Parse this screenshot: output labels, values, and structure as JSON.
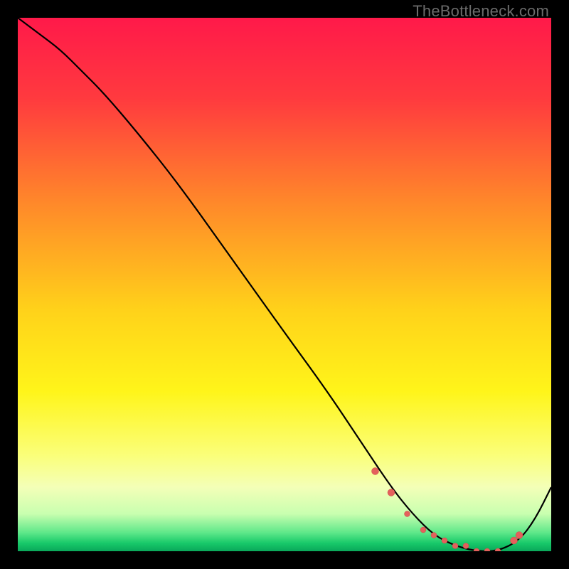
{
  "watermark": "TheBottleneck.com",
  "colors": {
    "bg": "#000000",
    "curve": "#000000",
    "marker_fill": "#e4605c",
    "marker_stroke": "#c94f4b"
  },
  "chart_data": {
    "type": "line",
    "title": "",
    "xlabel": "",
    "ylabel": "",
    "xlim": [
      0,
      100
    ],
    "ylim": [
      0,
      100
    ],
    "gradient_stops": [
      {
        "offset": 0.0,
        "color": "#ff1a4a"
      },
      {
        "offset": 0.15,
        "color": "#ff3a3f"
      },
      {
        "offset": 0.35,
        "color": "#ff8a2a"
      },
      {
        "offset": 0.55,
        "color": "#ffd31a"
      },
      {
        "offset": 0.7,
        "color": "#fff51a"
      },
      {
        "offset": 0.82,
        "color": "#fbff7a"
      },
      {
        "offset": 0.88,
        "color": "#f4ffb8"
      },
      {
        "offset": 0.93,
        "color": "#c9ffb0"
      },
      {
        "offset": 0.965,
        "color": "#5fe88a"
      },
      {
        "offset": 0.985,
        "color": "#18c96a"
      },
      {
        "offset": 1.0,
        "color": "#0aa85a"
      }
    ],
    "series": [
      {
        "name": "bottleneck-curve",
        "x": [
          0,
          4,
          8,
          12,
          16,
          22,
          30,
          40,
          50,
          58,
          64,
          70,
          74,
          78,
          82,
          86,
          90,
          94,
          97,
          100
        ],
        "y": [
          100,
          97,
          94,
          90,
          86,
          79,
          69,
          55,
          41,
          30,
          21,
          12,
          7,
          3,
          1,
          0,
          0,
          2,
          6,
          12
        ]
      }
    ],
    "markers": {
      "name": "highlight-points",
      "x": [
        67,
        70,
        73,
        76,
        78,
        80,
        82,
        84,
        86,
        88,
        90,
        93,
        94
      ],
      "y": [
        15,
        11,
        7,
        4,
        3,
        2,
        1,
        1,
        0,
        0,
        0,
        2,
        3
      ],
      "r": [
        5,
        5,
        4,
        4,
        4,
        4,
        4,
        4,
        4,
        4,
        4,
        5,
        5
      ]
    }
  }
}
